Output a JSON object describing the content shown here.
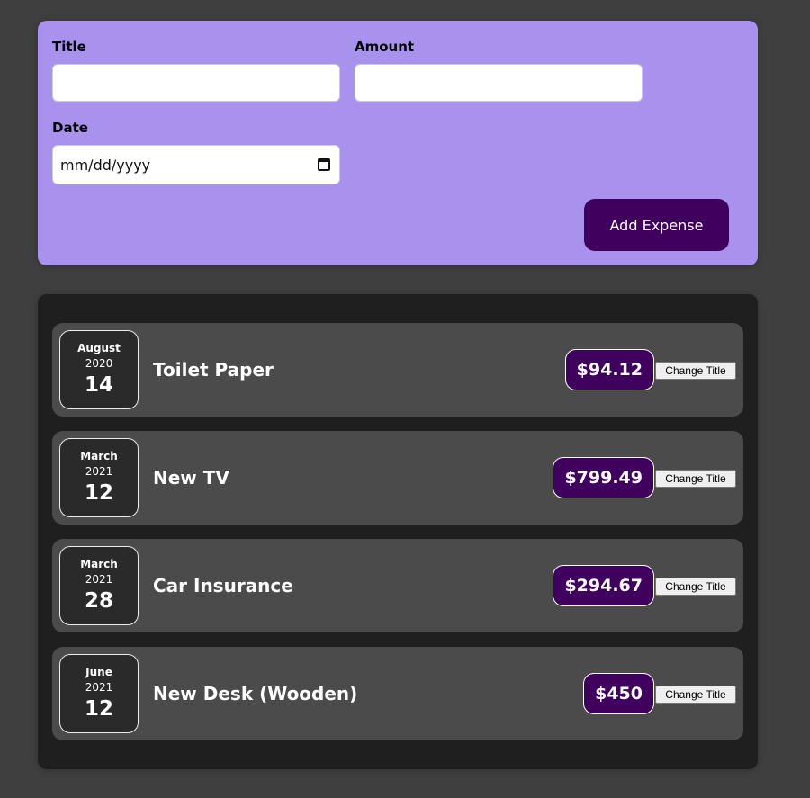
{
  "form": {
    "title_label": "Title",
    "title_value": "",
    "amount_label": "Amount",
    "amount_value": "",
    "date_label": "Date",
    "date_placeholder": "mm/dd/yyyy",
    "submit_label": "Add Expense"
  },
  "expenses": [
    {
      "month": "August",
      "year": "2020",
      "day": "14",
      "title": "Toilet Paper",
      "amount": "$94.12",
      "action_label": "Change Title"
    },
    {
      "month": "March",
      "year": "2021",
      "day": "12",
      "title": "New TV",
      "amount": "$799.49",
      "action_label": "Change Title"
    },
    {
      "month": "March",
      "year": "2021",
      "day": "28",
      "title": "Car Insurance",
      "amount": "$294.67",
      "action_label": "Change Title"
    },
    {
      "month": "June",
      "year": "2021",
      "day": "12",
      "title": "New Desk (Wooden)",
      "amount": "$450",
      "action_label": "Change Title"
    }
  ],
  "colors": {
    "page_bg": "#3f3f3f",
    "form_bg": "#a892ee",
    "list_bg": "#1f1f1f",
    "item_bg": "#4b4b4b",
    "accent": "#40005d"
  },
  "icons": {
    "date_picker": "calendar-icon"
  }
}
